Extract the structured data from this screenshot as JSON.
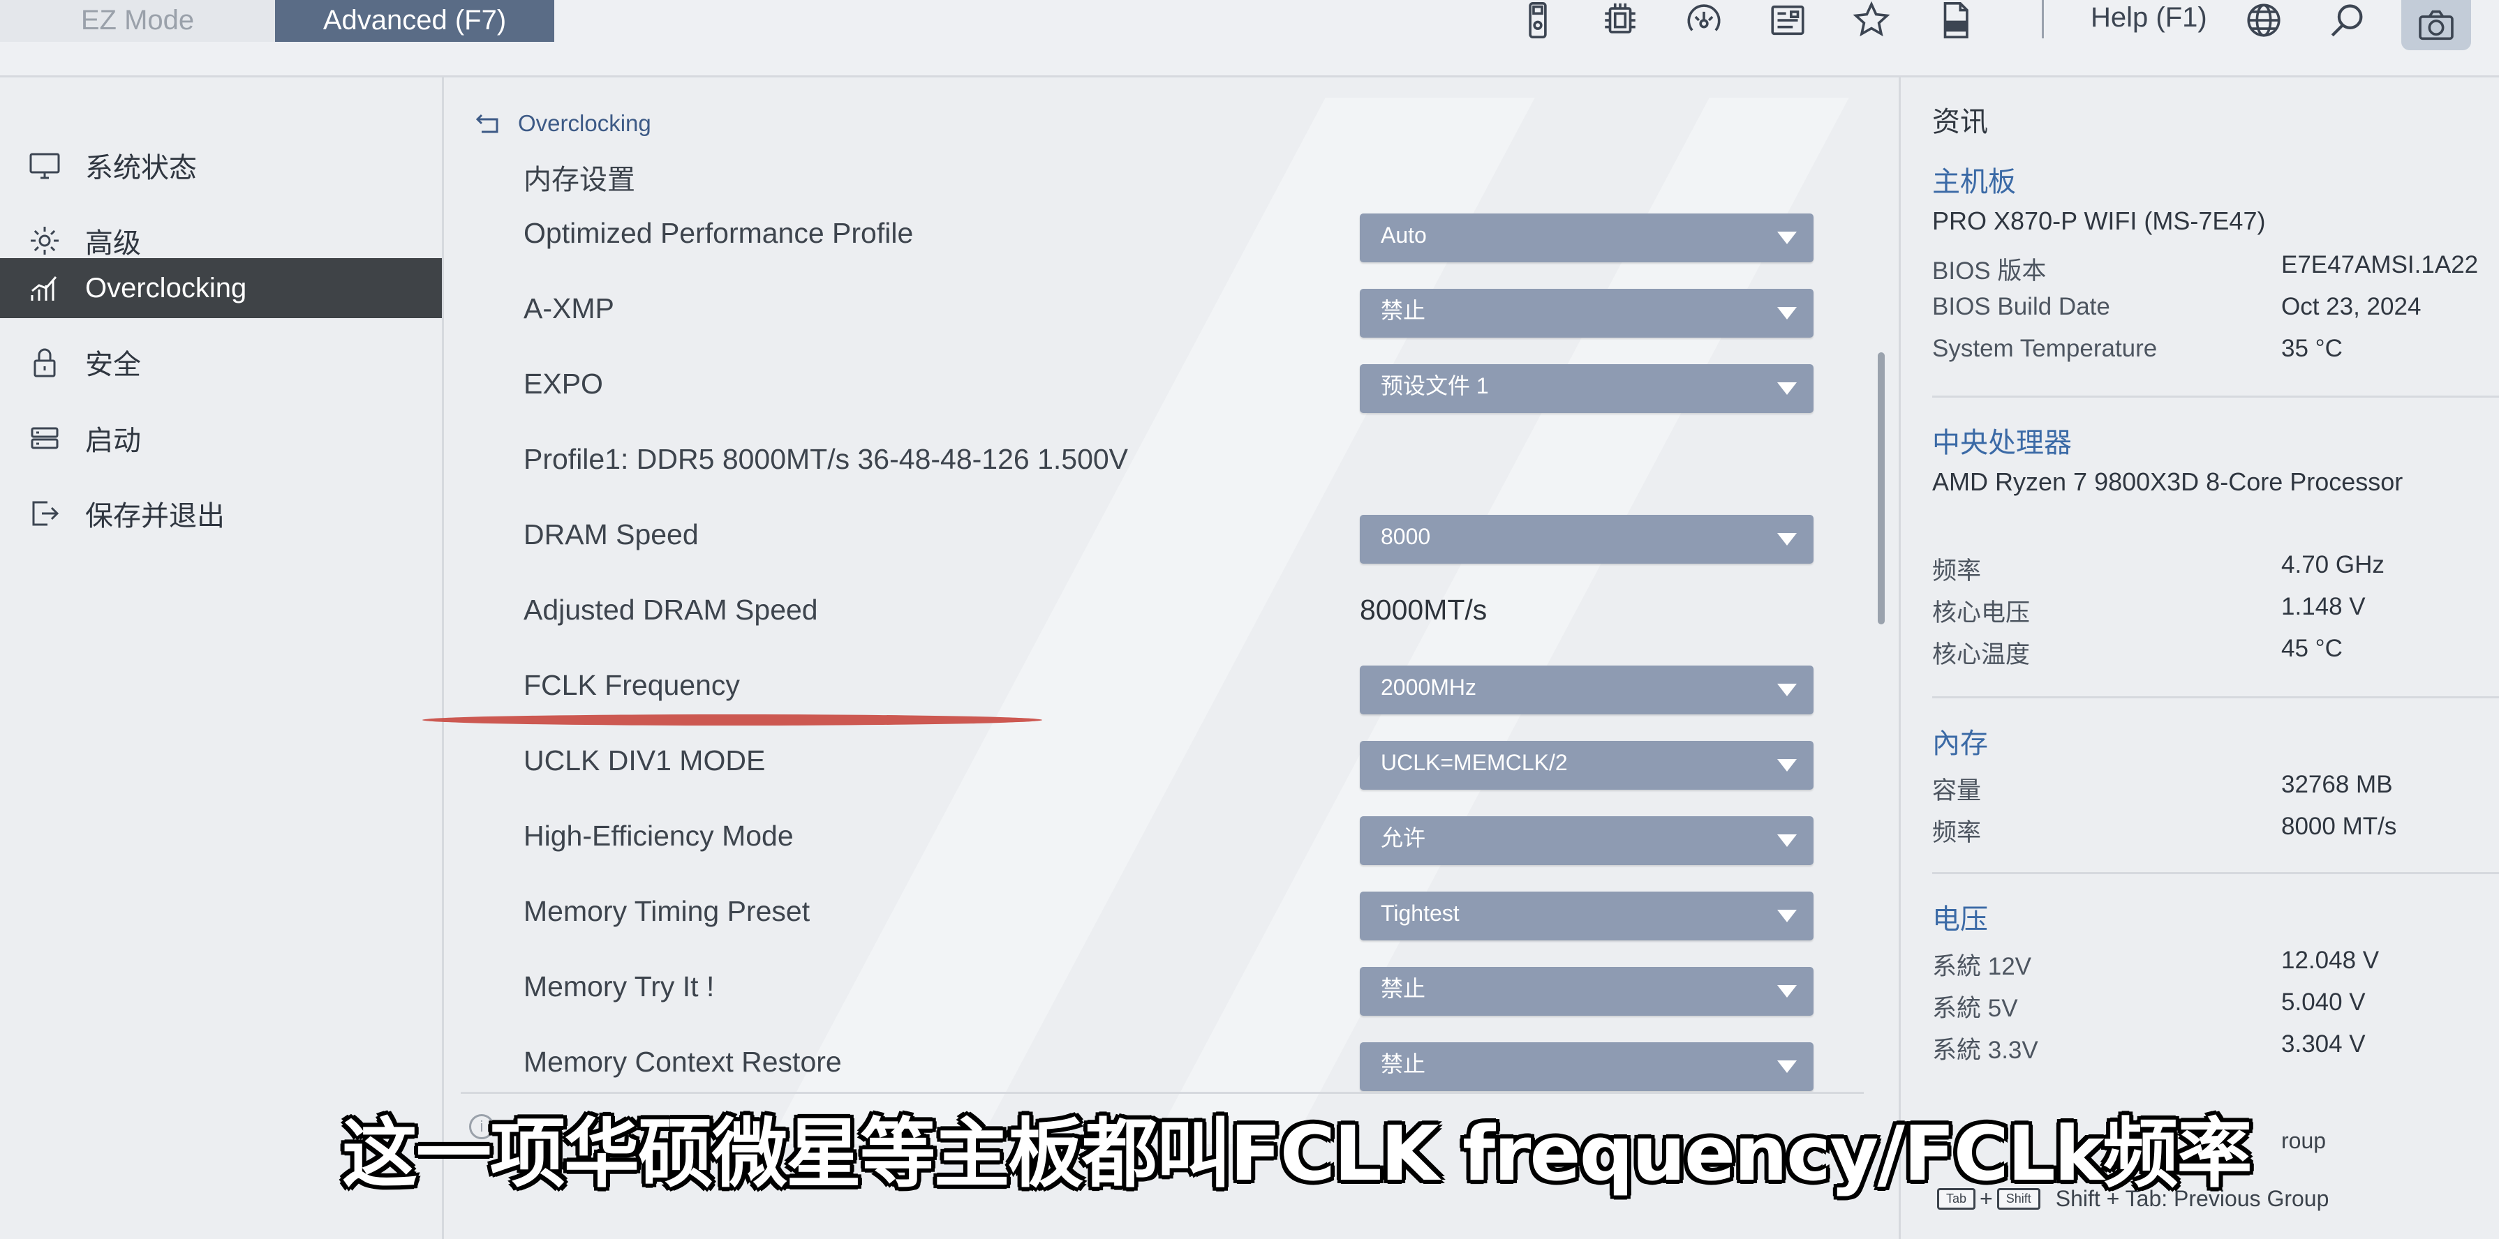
{
  "mode_tabs": {
    "ez": "EZ Mode",
    "advanced": "Advanced (F7)"
  },
  "topbar": {
    "help_label": "Help (F1)",
    "icons": [
      "usb-drive-icon",
      "cpu-chip-icon",
      "fan-icon",
      "board-explorer-icon",
      "favorite-star-icon",
      "log-file-icon",
      "language-globe-icon",
      "search-icon",
      "screenshot-camera-icon"
    ]
  },
  "leftnav": {
    "items": [
      {
        "label": "系统状态",
        "icon": "monitor-icon"
      },
      {
        "label": "高级",
        "icon": "gear-icon"
      },
      {
        "label": "Overclocking",
        "icon": "speed-chart-icon"
      },
      {
        "label": "安全",
        "icon": "lock-icon"
      },
      {
        "label": "启动",
        "icon": "boot-drive-icon"
      },
      {
        "label": "保存并退出",
        "icon": "exit-icon"
      }
    ],
    "active_index": 2
  },
  "main": {
    "breadcrumb": "Overclocking",
    "section_title": "内存设置",
    "settings": [
      {
        "label": "Optimized Performance Profile",
        "value": "Auto",
        "type": "dropdown"
      },
      {
        "label": "A-XMP",
        "value": "禁止",
        "type": "dropdown"
      },
      {
        "label": "EXPO",
        "value": "预设文件 1",
        "type": "dropdown"
      },
      {
        "label": "Profile1: DDR5 8000MT/s 36-48-48-126 1.500V",
        "value": "",
        "type": "text"
      },
      {
        "label": "DRAM Speed",
        "value": "8000",
        "type": "dropdown"
      },
      {
        "label": "Adjusted DRAM Speed",
        "value": "8000MT/s",
        "type": "readonly"
      },
      {
        "label": "FCLK Frequency",
        "value": "2000MHz",
        "type": "dropdown"
      },
      {
        "label": "UCLK DIV1 MODE",
        "value": "UCLK=MEMCLK/2",
        "type": "dropdown"
      },
      {
        "label": "High-Efficiency Mode",
        "value": "允许",
        "type": "dropdown"
      },
      {
        "label": "Memory Timing Preset",
        "value": "Tightest",
        "type": "dropdown"
      },
      {
        "label": "Memory Try It !",
        "value": "禁止",
        "type": "dropdown"
      },
      {
        "label": "Memory Context Restore",
        "value": "禁止",
        "type": "dropdown"
      }
    ]
  },
  "info_panel": {
    "title": "资讯",
    "motherboard": {
      "heading": "主机板",
      "model": "PRO X870-P WIFI (MS-7E47)",
      "rows": [
        {
          "label": "BIOS 版本",
          "value": "E7E47AMSI.1A22"
        },
        {
          "label": "BIOS Build Date",
          "value": "Oct 23, 2024"
        },
        {
          "label": "System Temperature",
          "value": "35 °C"
        }
      ]
    },
    "cpu": {
      "heading": "中央处理器",
      "model": "AMD Ryzen 7 9800X3D 8-Core Processor",
      "rows": [
        {
          "label": "频率",
          "value": "4.70 GHz"
        },
        {
          "label": "核心电压",
          "value": "1.148 V"
        },
        {
          "label": "核心温度",
          "value": "45 °C"
        }
      ]
    },
    "memory": {
      "heading": "內存",
      "rows": [
        {
          "label": "容量",
          "value": "32768 MB"
        },
        {
          "label": "频率",
          "value": "8000 MT/s"
        }
      ]
    },
    "voltage": {
      "heading": "电压",
      "rows": [
        {
          "label": "系統 12V",
          "value": "12.048 V"
        },
        {
          "label": "系統 5V",
          "value": "5.040 V"
        },
        {
          "label": "系統 3.3V",
          "value": "3.304 V"
        }
      ]
    },
    "key_hints": {
      "next_group_suffix": "roup",
      "tab_key": "Tab",
      "shift_key": "Shift",
      "plus": "+",
      "prev_group": "Shift + Tab: Previous Group"
    }
  },
  "subtitle": "这一项华硕微星等主板都叫FCLK frequency/FCLk频率"
}
